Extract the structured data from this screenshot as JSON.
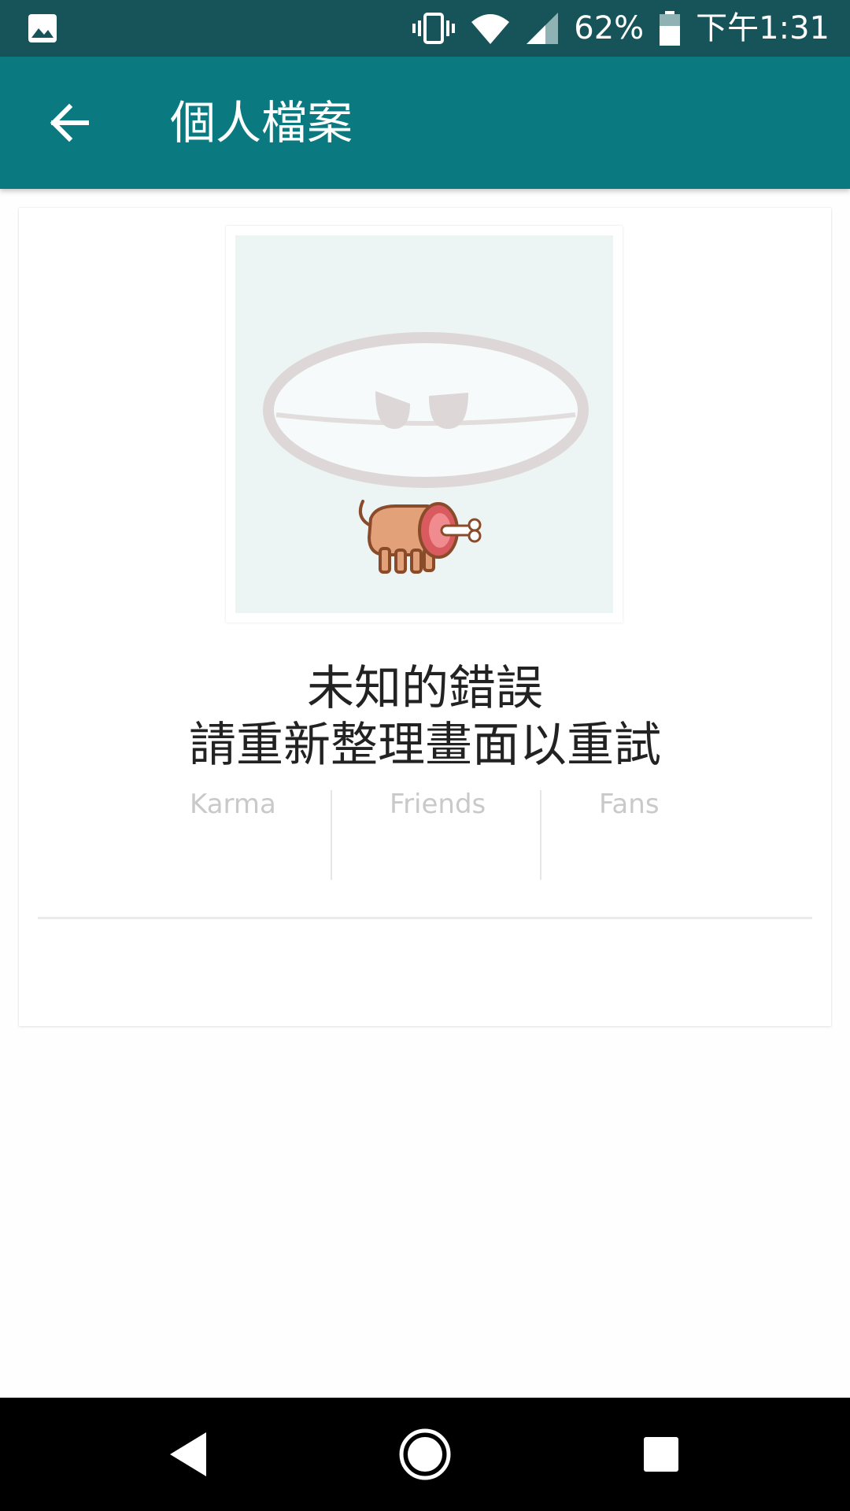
{
  "status_bar": {
    "battery_percent": "62%",
    "time": "下午1:31",
    "icons": [
      "gallery-icon",
      "vibrate-icon",
      "wifi-icon",
      "cell-signal-icon",
      "battery-icon"
    ]
  },
  "toolbar": {
    "title": "個人檔案",
    "back_icon": "arrow-left-icon",
    "background_color": "#0b7a80"
  },
  "profile": {
    "avatar_icon": "error-illustration-icon",
    "error_line1": "未知的錯誤",
    "error_line2": "請重新整理畫面以重試",
    "stats": [
      {
        "label": "Karma",
        "value": ""
      },
      {
        "label": "Friends",
        "value": ""
      },
      {
        "label": "Fans",
        "value": ""
      }
    ]
  },
  "nav_bar": {
    "icons": [
      "nav-back-icon",
      "nav-home-icon",
      "nav-recents-icon"
    ]
  },
  "colors": {
    "status_bar": "#17545a",
    "toolbar": "#0b7a80",
    "stat_label": "#c9c9c9"
  }
}
